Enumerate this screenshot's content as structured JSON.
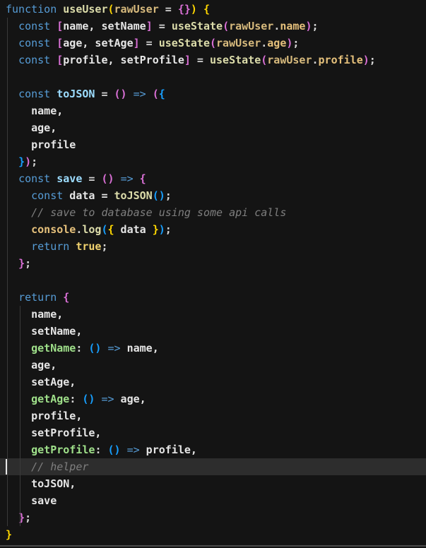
{
  "colors": {
    "background": "#141414",
    "current_line": "#2d2d2d",
    "keyword": "#569cd6",
    "function": "#dcdcaa",
    "variable": "#9cdcfe",
    "comment": "#7f7f7f"
  },
  "code": {
    "current_line_index": 27,
    "lines": [
      [
        {
          "t": "function",
          "c": "kw"
        },
        {
          "t": " ",
          "c": "txt"
        },
        {
          "t": "useUser",
          "c": "fn"
        },
        {
          "t": "(",
          "c": "br1"
        },
        {
          "t": "rawUser",
          "c": "param"
        },
        {
          "t": " = ",
          "c": "txt"
        },
        {
          "t": "{}",
          "c": "br2"
        },
        {
          "t": ")",
          "c": "br1"
        },
        {
          "t": " ",
          "c": "txt"
        },
        {
          "t": "{",
          "c": "br1"
        }
      ],
      [
        {
          "t": "  ",
          "c": "txt"
        },
        {
          "t": "const",
          "c": "kw"
        },
        {
          "t": " ",
          "c": "txt"
        },
        {
          "t": "[",
          "c": "br2"
        },
        {
          "t": "name, setName",
          "c": "id"
        },
        {
          "t": "]",
          "c": "br2"
        },
        {
          "t": " = ",
          "c": "txt"
        },
        {
          "t": "useState",
          "c": "fn"
        },
        {
          "t": "(",
          "c": "br2"
        },
        {
          "t": "rawUser",
          "c": "param"
        },
        {
          "t": ".",
          "c": "txt"
        },
        {
          "t": "name",
          "c": "prop"
        },
        {
          "t": ")",
          "c": "br2"
        },
        {
          "t": ";",
          "c": "txt"
        }
      ],
      [
        {
          "t": "  ",
          "c": "txt"
        },
        {
          "t": "const",
          "c": "kw"
        },
        {
          "t": " ",
          "c": "txt"
        },
        {
          "t": "[",
          "c": "br2"
        },
        {
          "t": "age, setAge",
          "c": "id"
        },
        {
          "t": "]",
          "c": "br2"
        },
        {
          "t": " = ",
          "c": "txt"
        },
        {
          "t": "useState",
          "c": "fn"
        },
        {
          "t": "(",
          "c": "br2"
        },
        {
          "t": "rawUser",
          "c": "param"
        },
        {
          "t": ".",
          "c": "txt"
        },
        {
          "t": "age",
          "c": "prop"
        },
        {
          "t": ")",
          "c": "br2"
        },
        {
          "t": ";",
          "c": "txt"
        }
      ],
      [
        {
          "t": "  ",
          "c": "txt"
        },
        {
          "t": "const",
          "c": "kw"
        },
        {
          "t": " ",
          "c": "txt"
        },
        {
          "t": "[",
          "c": "br2"
        },
        {
          "t": "profile, setProfile",
          "c": "id"
        },
        {
          "t": "]",
          "c": "br2"
        },
        {
          "t": " = ",
          "c": "txt"
        },
        {
          "t": "useState",
          "c": "fn"
        },
        {
          "t": "(",
          "c": "br2"
        },
        {
          "t": "rawUser",
          "c": "param"
        },
        {
          "t": ".",
          "c": "txt"
        },
        {
          "t": "profile",
          "c": "prop"
        },
        {
          "t": ")",
          "c": "br2"
        },
        {
          "t": ";",
          "c": "txt"
        }
      ],
      [],
      [
        {
          "t": "  ",
          "c": "txt"
        },
        {
          "t": "const",
          "c": "kw"
        },
        {
          "t": " ",
          "c": "txt"
        },
        {
          "t": "toJSON",
          "c": "var"
        },
        {
          "t": " = ",
          "c": "txt"
        },
        {
          "t": "()",
          "c": "br2"
        },
        {
          "t": " ",
          "c": "txt"
        },
        {
          "t": "=>",
          "c": "kw"
        },
        {
          "t": " ",
          "c": "txt"
        },
        {
          "t": "(",
          "c": "br2"
        },
        {
          "t": "{",
          "c": "br3"
        }
      ],
      [
        {
          "t": "    name,",
          "c": "id"
        }
      ],
      [
        {
          "t": "    age,",
          "c": "id"
        }
      ],
      [
        {
          "t": "    profile",
          "c": "id"
        }
      ],
      [
        {
          "t": "  ",
          "c": "txt"
        },
        {
          "t": "}",
          "c": "br3"
        },
        {
          "t": ")",
          "c": "br2"
        },
        {
          "t": ";",
          "c": "txt"
        }
      ],
      [
        {
          "t": "  ",
          "c": "txt"
        },
        {
          "t": "const",
          "c": "kw"
        },
        {
          "t": " ",
          "c": "txt"
        },
        {
          "t": "save",
          "c": "var"
        },
        {
          "t": " = ",
          "c": "txt"
        },
        {
          "t": "()",
          "c": "br2"
        },
        {
          "t": " ",
          "c": "txt"
        },
        {
          "t": "=>",
          "c": "kw"
        },
        {
          "t": " ",
          "c": "txt"
        },
        {
          "t": "{",
          "c": "br2"
        }
      ],
      [
        {
          "t": "    ",
          "c": "txt"
        },
        {
          "t": "const",
          "c": "kw"
        },
        {
          "t": " data = ",
          "c": "id"
        },
        {
          "t": "toJSON",
          "c": "fn"
        },
        {
          "t": "()",
          "c": "br3"
        },
        {
          "t": ";",
          "c": "txt"
        }
      ],
      [
        {
          "t": "    ",
          "c": "txt"
        },
        {
          "t": "// save to database using some api calls",
          "c": "comment"
        }
      ],
      [
        {
          "t": "    ",
          "c": "txt"
        },
        {
          "t": "console",
          "c": "prop"
        },
        {
          "t": ".",
          "c": "txt"
        },
        {
          "t": "log",
          "c": "fn"
        },
        {
          "t": "(",
          "c": "br3"
        },
        {
          "t": "{",
          "c": "br1"
        },
        {
          "t": " data ",
          "c": "id"
        },
        {
          "t": "}",
          "c": "br1"
        },
        {
          "t": ")",
          "c": "br3"
        },
        {
          "t": ";",
          "c": "txt"
        }
      ],
      [
        {
          "t": "    ",
          "c": "txt"
        },
        {
          "t": "return",
          "c": "kw"
        },
        {
          "t": " ",
          "c": "txt"
        },
        {
          "t": "true",
          "c": "bool"
        },
        {
          "t": ";",
          "c": "txt"
        }
      ],
      [
        {
          "t": "  ",
          "c": "txt"
        },
        {
          "t": "}",
          "c": "br2"
        },
        {
          "t": ";",
          "c": "txt"
        }
      ],
      [],
      [
        {
          "t": "  ",
          "c": "txt"
        },
        {
          "t": "return",
          "c": "kw"
        },
        {
          "t": " ",
          "c": "txt"
        },
        {
          "t": "{",
          "c": "br2"
        }
      ],
      [
        {
          "t": "    name,",
          "c": "id"
        }
      ],
      [
        {
          "t": "    setName,",
          "c": "id"
        }
      ],
      [
        {
          "t": "    ",
          "c": "txt"
        },
        {
          "t": "getName",
          "c": "prop2"
        },
        {
          "t": ": ",
          "c": "txt"
        },
        {
          "t": "()",
          "c": "br3"
        },
        {
          "t": " ",
          "c": "txt"
        },
        {
          "t": "=>",
          "c": "kw"
        },
        {
          "t": " name,",
          "c": "id"
        }
      ],
      [
        {
          "t": "    age,",
          "c": "id"
        }
      ],
      [
        {
          "t": "    setAge,",
          "c": "id"
        }
      ],
      [
        {
          "t": "    ",
          "c": "txt"
        },
        {
          "t": "getAge",
          "c": "prop2"
        },
        {
          "t": ": ",
          "c": "txt"
        },
        {
          "t": "()",
          "c": "br3"
        },
        {
          "t": " ",
          "c": "txt"
        },
        {
          "t": "=>",
          "c": "kw"
        },
        {
          "t": " age,",
          "c": "id"
        }
      ],
      [
        {
          "t": "    profile,",
          "c": "id"
        }
      ],
      [
        {
          "t": "    setProfile,",
          "c": "id"
        }
      ],
      [
        {
          "t": "    ",
          "c": "txt"
        },
        {
          "t": "getProfile",
          "c": "prop2"
        },
        {
          "t": ": ",
          "c": "txt"
        },
        {
          "t": "()",
          "c": "br3"
        },
        {
          "t": " ",
          "c": "txt"
        },
        {
          "t": "=>",
          "c": "kw"
        },
        {
          "t": " profile,",
          "c": "id"
        }
      ],
      [
        {
          "t": "    ",
          "c": "txt"
        },
        {
          "t": "// helper",
          "c": "comment"
        }
      ],
      [
        {
          "t": "    toJSON,",
          "c": "id"
        }
      ],
      [
        {
          "t": "    save",
          "c": "id"
        }
      ],
      [
        {
          "t": "  ",
          "c": "txt"
        },
        {
          "t": "}",
          "c": "br2"
        },
        {
          "t": ";",
          "c": "txt"
        }
      ],
      [
        {
          "t": "}",
          "c": "br1"
        }
      ]
    ]
  }
}
